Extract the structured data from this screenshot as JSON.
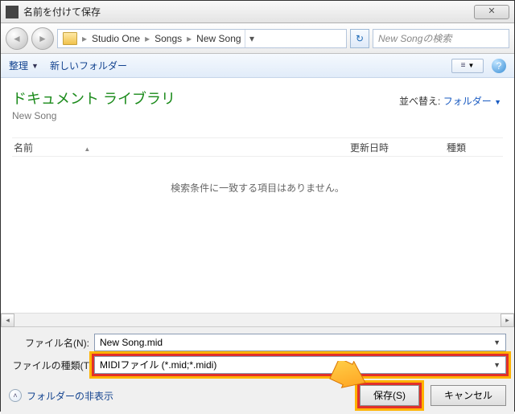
{
  "title": "名前を付けて保存",
  "breadcrumb": {
    "p1": "Studio One",
    "p2": "Songs",
    "p3": "New Song"
  },
  "search": {
    "placeholder": "New Songの検索"
  },
  "toolbar": {
    "organize": "整理",
    "newfolder": "新しいフォルダー"
  },
  "library": {
    "heading": "ドキュメント ライブラリ",
    "sub": "New Song"
  },
  "sort": {
    "label": "並べ替え:",
    "value": "フォルダー"
  },
  "cols": {
    "name": "名前",
    "date": "更新日時",
    "type": "種類"
  },
  "empty": "検索条件に一致する項目はありません。",
  "filename": {
    "label": "ファイル名(N):",
    "value": "New Song.mid"
  },
  "filetype": {
    "label": "ファイルの種類(T",
    "value": "MIDIファイル (*.mid;*.midi)"
  },
  "folders": "フォルダーの非表示",
  "buttons": {
    "save": "保存(S)",
    "cancel": "キャンセル"
  },
  "close": "✕"
}
